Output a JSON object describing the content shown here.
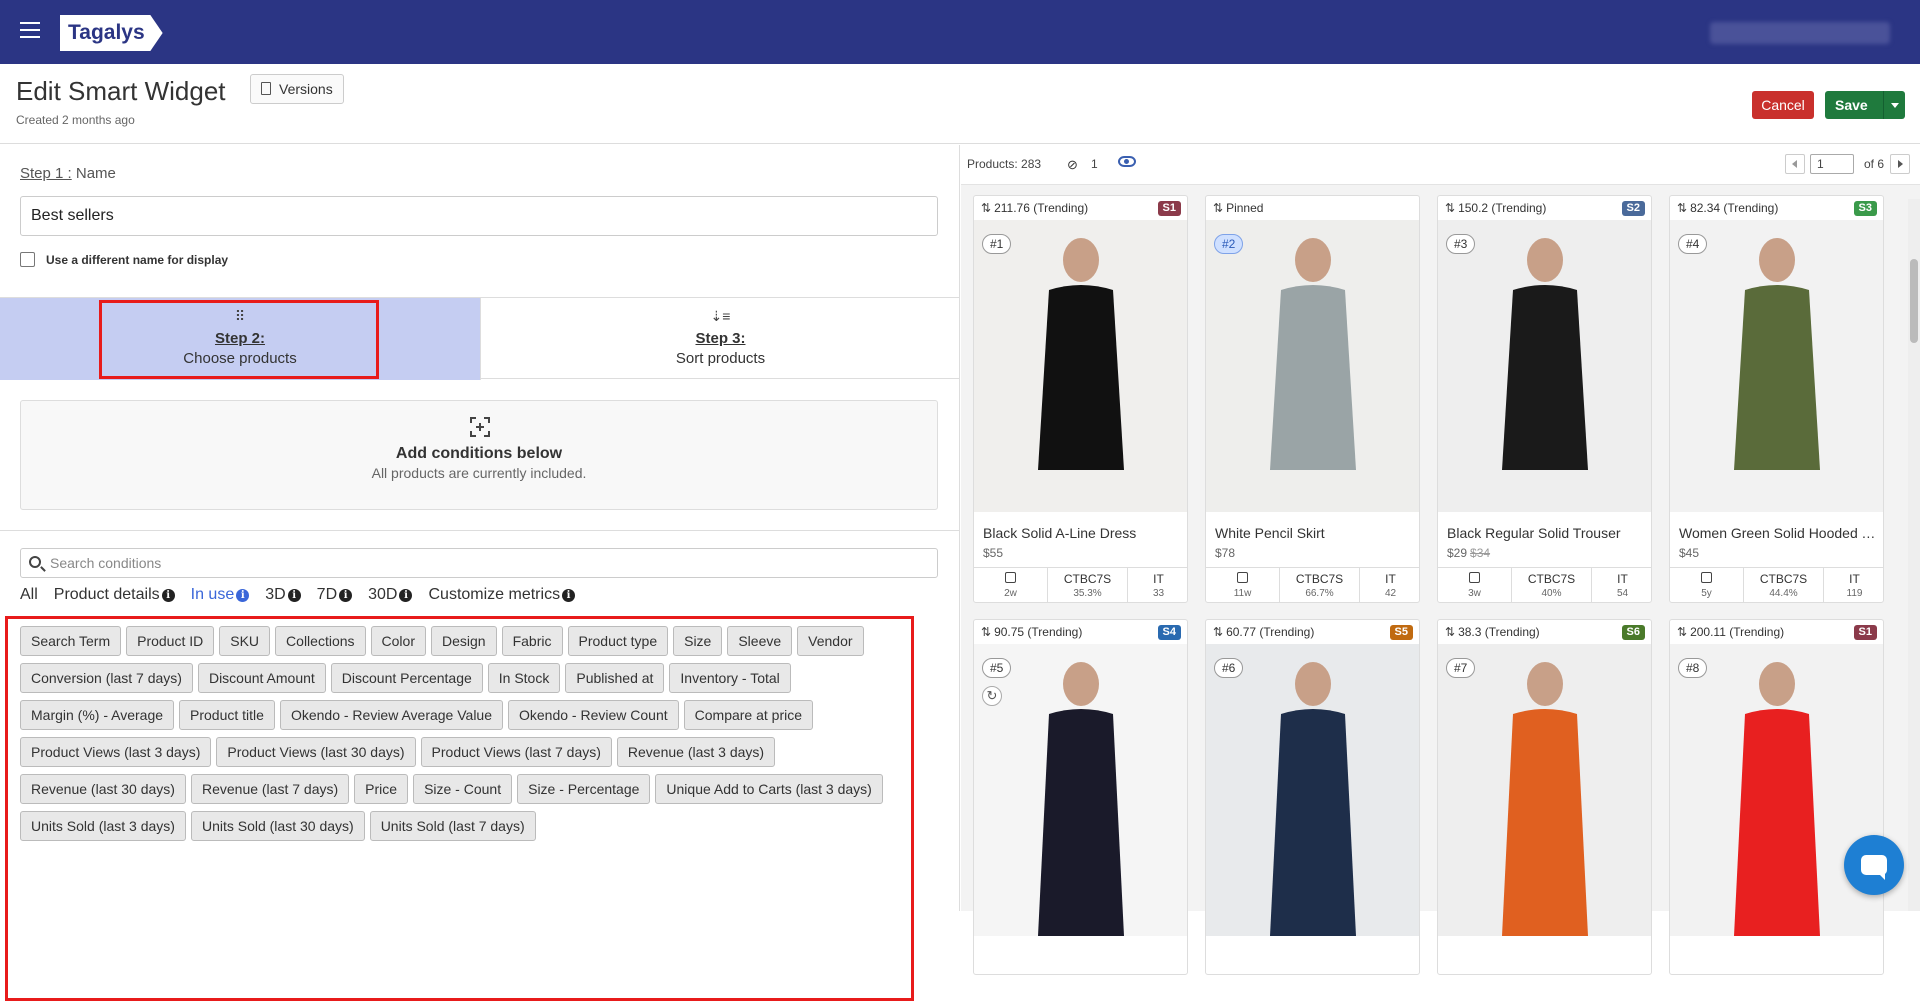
{
  "app": {
    "logo": "Tagalys"
  },
  "header": {
    "title": "Edit Smart Widget",
    "versions_label": "Versions",
    "created": "Created 2 months ago",
    "cancel_label": "Cancel",
    "save_label": "Save"
  },
  "step1": {
    "label_prefix": "Step 1 :",
    "label_suffix": "Name",
    "name_value": "Best sellers",
    "display_name_checkbox": "Use a different name for display",
    "display_name_checked": false
  },
  "steps": {
    "step2_title": "Step 2:",
    "step2_sub": "Choose products",
    "step3_title": "Step 3:",
    "step3_sub": "Sort products"
  },
  "conditions": {
    "title": "Add conditions below",
    "subtitle": "All products are currently included.",
    "search_placeholder": "Search conditions",
    "filter_tabs": [
      {
        "label": "All",
        "info": false
      },
      {
        "label": "Product details",
        "info": true
      },
      {
        "label": "In use",
        "info": true,
        "active": true
      },
      {
        "label": "3D",
        "info": true
      },
      {
        "label": "7D",
        "info": true
      },
      {
        "label": "30D",
        "info": true
      },
      {
        "label": "Customize metrics",
        "info": true
      }
    ],
    "chips": [
      "Search Term",
      "Product ID",
      "SKU",
      "Collections",
      "Color",
      "Design",
      "Fabric",
      "Product type",
      "Size",
      "Sleeve",
      "Vendor",
      "Conversion (last 7 days)",
      "Discount Amount",
      "Discount Percentage",
      "In Stock",
      "Published at",
      "Inventory - Total",
      "Margin (%) - Average",
      "Product title",
      "Okendo - Review Average Value",
      "Okendo - Review Count",
      "Compare at price",
      "Product Views (last 3 days)",
      "Product Views (last 30 days)",
      "Product Views (last 7 days)",
      "Revenue (last 3 days)",
      "Revenue (last 30 days)",
      "Revenue (last 7 days)",
      "Price",
      "Size - Count",
      "Size - Percentage",
      "Unique Add to Carts (last 3 days)",
      "Units Sold (last 3 days)",
      "Units Sold (last 30 days)",
      "Units Sold (last 7 days)"
    ]
  },
  "products_bar": {
    "products_label": "Products:",
    "products_count": "283",
    "hidden_count": "1",
    "page_value": "1",
    "page_of": "of 6"
  },
  "products": [
    {
      "score": "211.76 (Trending)",
      "badge": "S1",
      "badge_color": "#8b3a4a",
      "rank": "#1",
      "name": "Black Solid A-Line Dress",
      "price": "$55",
      "compare": "",
      "c1_val": "2w",
      "c2_lbl": "CTBC7S",
      "c2_val": "35.3%",
      "c3_lbl": "IT",
      "c3_val": "33",
      "colors": [
        "#f0efed",
        "#111111"
      ]
    },
    {
      "score": "Pinned",
      "badge": "",
      "badge_color": "",
      "rank": "#2",
      "pinned": true,
      "name": "White Pencil Skirt",
      "price": "$78",
      "compare": "",
      "c1_val": "11w",
      "c2_lbl": "CTBC7S",
      "c2_val": "66.7%",
      "c3_lbl": "IT",
      "c3_val": "42",
      "colors": [
        "#eeeeec",
        "#9aa4a6"
      ]
    },
    {
      "score": "150.2 (Trending)",
      "badge": "S2",
      "badge_color": "#4a6a9a",
      "rank": "#3",
      "name": "Black Regular Solid Trouser",
      "price": "$29",
      "compare": "$34",
      "c1_val": "3w",
      "c2_lbl": "CTBC7S",
      "c2_val": "40%",
      "c3_lbl": "IT",
      "c3_val": "54",
      "colors": [
        "#eeeeee",
        "#1a1a1a"
      ]
    },
    {
      "score": "82.34 (Trending)",
      "badge": "S3",
      "badge_color": "#3a9a4a",
      "rank": "#4",
      "name": "Women Green Solid Hooded T...",
      "price": "$45",
      "compare": "",
      "c1_val": "5y",
      "c2_lbl": "CTBC7S",
      "c2_val": "44.4%",
      "c3_lbl": "IT",
      "c3_val": "119",
      "colors": [
        "#f2f2f2",
        "#5a6b3a"
      ]
    },
    {
      "score": "90.75 (Trending)",
      "badge": "S4",
      "badge_color": "#2a6ab0",
      "rank": "#5",
      "name": "",
      "price": "",
      "compare": "",
      "c1_val": "",
      "c2_lbl": "",
      "c2_val": "",
      "c3_lbl": "",
      "c3_val": "",
      "colors": [
        "#f5f5f5",
        "#1a1a2a"
      ]
    },
    {
      "score": "60.77 (Trending)",
      "badge": "S5",
      "badge_color": "#c06a10",
      "rank": "#6",
      "name": "",
      "price": "",
      "compare": "",
      "c1_val": "",
      "c2_lbl": "",
      "c2_val": "",
      "c3_lbl": "",
      "c3_val": "",
      "colors": [
        "#e8eaec",
        "#1e2e4a"
      ]
    },
    {
      "score": "38.3 (Trending)",
      "badge": "S6",
      "badge_color": "#4a7a2a",
      "rank": "#7",
      "name": "",
      "price": "",
      "compare": "",
      "c1_val": "",
      "c2_lbl": "",
      "c2_val": "",
      "c3_lbl": "",
      "c3_val": "",
      "colors": [
        "#eeeeee",
        "#e06020"
      ]
    },
    {
      "score": "200.11 (Trending)",
      "badge": "S1",
      "badge_color": "#8b3a4a",
      "rank": "#8",
      "name": "",
      "price": "",
      "compare": "",
      "c1_val": "",
      "c2_lbl": "",
      "c2_val": "",
      "c3_lbl": "",
      "c3_val": "",
      "colors": [
        "#f2f2f2",
        "#e82020"
      ]
    }
  ]
}
